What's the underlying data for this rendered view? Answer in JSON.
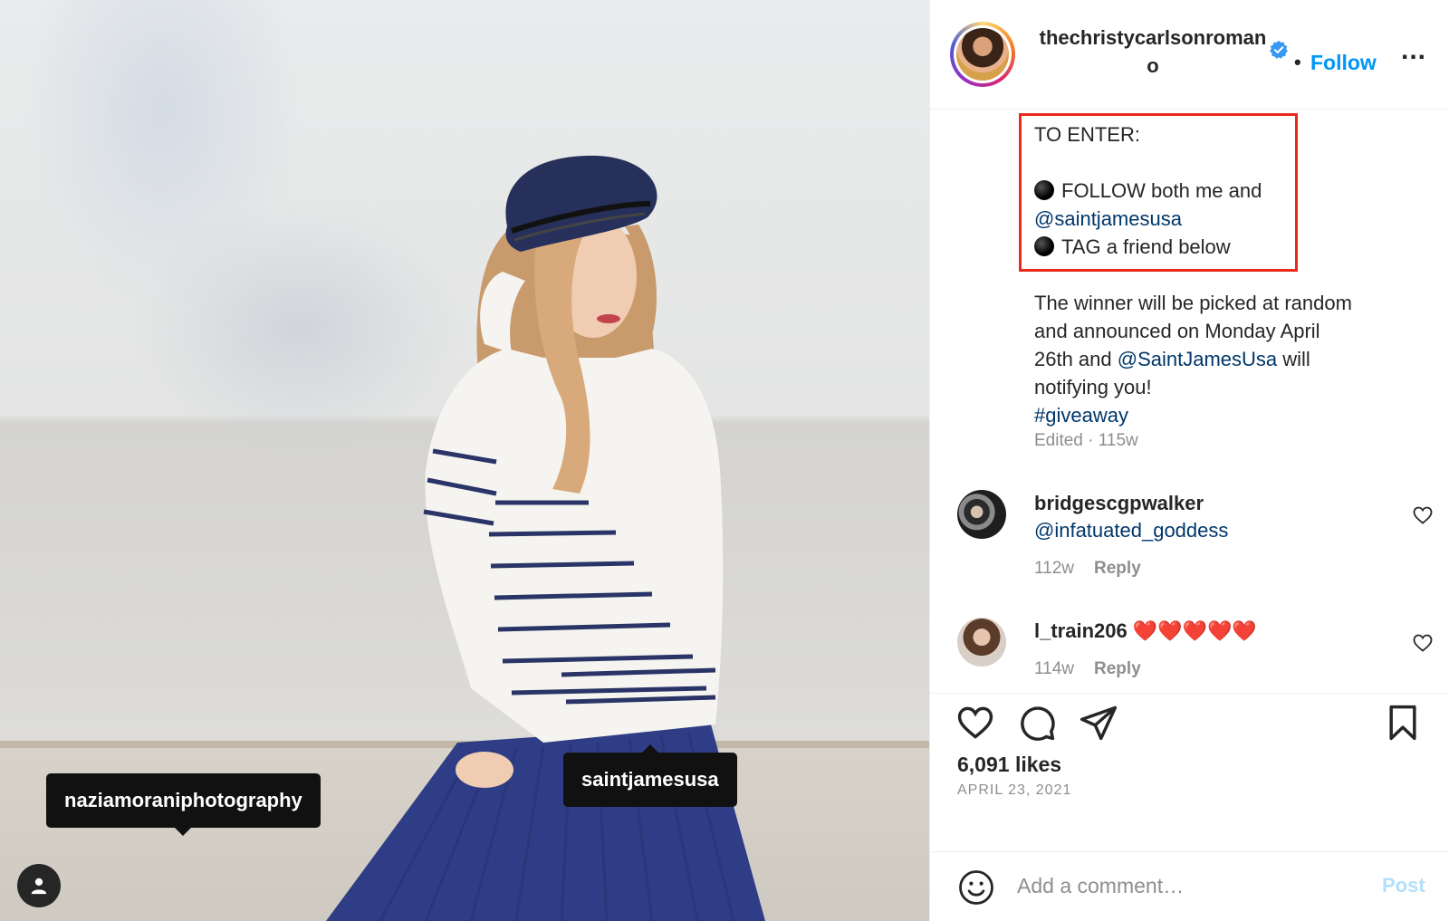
{
  "photo": {
    "tags": [
      {
        "label": "naziamoraniphotography"
      },
      {
        "label": "saintjamesusa"
      }
    ]
  },
  "header": {
    "username": "thechristycarlsonromano",
    "separator": "•",
    "follow_label": "Follow",
    "more_label": "..."
  },
  "caption": {
    "lines": [
      "TO ENTER:",
      "",
      "FOLLOW both me and",
      "@saintjamesusa",
      "TAG a friend below",
      "",
      "The winner will be picked at random",
      "and announced on Monday April",
      "26th and ",
      "@SaintJamesUsa",
      " will",
      "notifying you!",
      "#giveaway"
    ],
    "meta": "Edited · 115w"
  },
  "comments": [
    {
      "username": "bridgescgpwalker",
      "text": "@infatuated_goddess",
      "age": "112w",
      "reply_label": "Reply"
    },
    {
      "username": "l_train206",
      "text": "❤️❤️❤️❤️❤️",
      "age": "114w",
      "reply_label": "Reply"
    }
  ],
  "actions": {
    "likes": "6,091 likes",
    "date": "APRIL 23, 2021"
  },
  "add_comment": {
    "placeholder": "Add a comment…",
    "post_label": "Post"
  },
  "colors": {
    "accent": "#0095f6",
    "link": "#00376b",
    "highlight_box": "#e8291c",
    "muted": "#8e8e8e"
  },
  "icons": [
    "user-tag-icon",
    "verified-badge-icon",
    "heart-icon",
    "comment-icon",
    "share-icon",
    "bookmark-icon",
    "emoji-icon"
  ]
}
